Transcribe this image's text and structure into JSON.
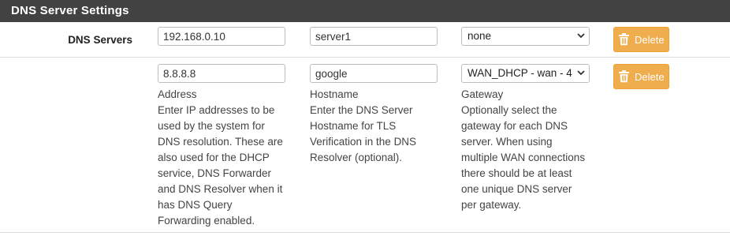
{
  "panel": {
    "title": "DNS Server Settings"
  },
  "rows": [
    {
      "label": "DNS Servers",
      "address": "192.168.0.10",
      "hostname": "server1",
      "gateway": "none",
      "delete_label": "Delete"
    },
    {
      "label": "",
      "address": "8.8.8.8",
      "hostname": "google",
      "gateway": "WAN_DHCP - wan - 4",
      "delete_label": "Delete"
    }
  ],
  "help": {
    "address_title": "Address",
    "address_text": "Enter IP addresses to be used by the system for DNS resolution. These are also used for the DHCP service, DNS Forwarder and DNS Resolver when it has DNS Query Forwarding enabled.",
    "hostname_title": "Hostname",
    "hostname_text": "Enter the DNS Server Hostname for TLS Verification in the DNS Resolver (optional).",
    "gateway_title": "Gateway",
    "gateway_text": "Optionally select the gateway for each DNS server. When using multiple WAN connections there should be at least one unique DNS server per gateway."
  },
  "colors": {
    "header_bg": "#424242",
    "delete_button": "#f0ad4e"
  },
  "icons": {
    "delete": "trash-icon",
    "select": "chevron-down-icon"
  }
}
